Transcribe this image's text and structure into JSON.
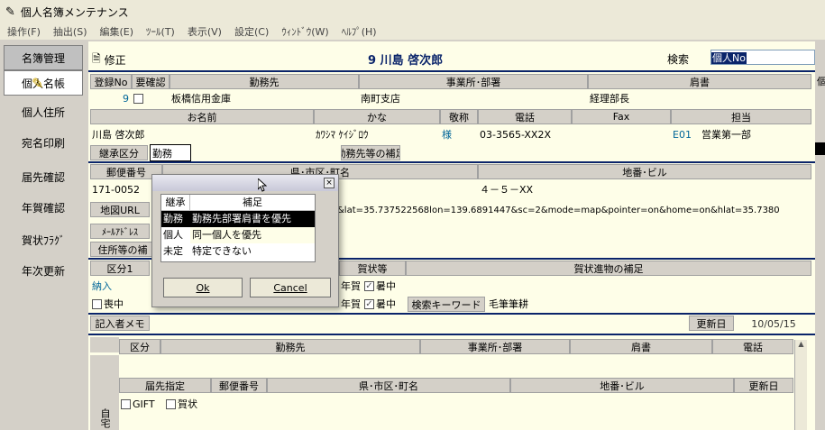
{
  "window": {
    "title": "個人名簿メンテナンス"
  },
  "menu": [
    "操作(F)",
    "抽出(S)",
    "編集(E)",
    "ﾂｰﾙ(T)",
    "表示(V)",
    "設定(C)",
    "ｳｨﾝﾄﾞｳ(W)",
    "ﾍﾙﾌﾟ(H)"
  ],
  "sidebar": {
    "header": "名簿管理",
    "items": [
      "個人名帳",
      "個人住所",
      "宛名印刷",
      "届先確認",
      "年賀確認",
      "賀状ﾌﾗｸﾞ",
      "年次更新"
    ]
  },
  "top": {
    "mode": "修正",
    "record": "9 川島 啓次郎",
    "search_label": "検索",
    "search_value": "個人No"
  },
  "headers1": {
    "no": "登録No",
    "confirm": "要確認",
    "company": "勤務先",
    "dept": "事業所･部署",
    "title": "肩書"
  },
  "row1": {
    "no": "9",
    "company": "板橋信用金庫",
    "dept": "南町支店",
    "title": "経理部長"
  },
  "headers2": {
    "name": "お名前",
    "kana": "かな",
    "honor": "敬称",
    "tel": "電話",
    "fax": "Fax",
    "rep": "担当"
  },
  "row2": {
    "name": "川島 啓次郎",
    "kana": "ｶﾜｼﾏ ｹｲｼﾞﾛｳ",
    "honor": "様",
    "tel": "03-3565-XX2X",
    "fax": "",
    "rep_code": "E01",
    "rep_name": "営業第一部"
  },
  "inherit": {
    "label": "継承区分",
    "value": "勤務",
    "supp_label": "勤務先等の補足"
  },
  "headers3": {
    "zip": "郵便番号",
    "pref": "県･市区･町名",
    "addr": "地番･ビル"
  },
  "row3": {
    "zip": "171-0052",
    "addr": "４－５－XX"
  },
  "map": {
    "label": "地図URL",
    "value": "&lat=35.737522568lon=139.6891447&sc=2&mode=map&pointer=on&home=on&hlat=35.7380"
  },
  "mail": {
    "label": "ﾒｰﾙｱﾄﾞﾚｽ"
  },
  "addr_supp": {
    "label": "住所等の補"
  },
  "section2": {
    "cat1_label": "区分1",
    "cat1_value": "納入",
    "mourning": "喪中",
    "nenga_label": "賀状等",
    "nenga": "年賀",
    "shochu": "暑中",
    "nenga_supp_label": "賀状進物の補足",
    "keyword_label": "検索キーワード",
    "keyword_value": "毛筆筆耕"
  },
  "memo": {
    "label": "記入者メモ",
    "updated_label": "更新日",
    "updated_value": "10/05/15"
  },
  "lower": {
    "headers": [
      "区分",
      "勤務先",
      "事業所･部署",
      "肩書",
      "電話"
    ],
    "headers2": [
      "届先指定",
      "郵便番号",
      "県･市区･町名",
      "地番･ビル",
      "更新日"
    ],
    "gift": "GIFT",
    "card": "賀状",
    "side_label": "自宅"
  },
  "dialog": {
    "col1": "継承",
    "col2": "補足",
    "rows": [
      {
        "k": "勤務",
        "v": "勤務先部署肩書を優先"
      },
      {
        "k": "個人",
        "v": "同一個人を優先"
      },
      {
        "k": "未定",
        "v": "特定できない"
      }
    ],
    "ok": "Ok",
    "cancel": "Cancel"
  },
  "colors": {
    "accent": "#0a246a",
    "teal": "#006699",
    "panel": "#fefee8"
  }
}
